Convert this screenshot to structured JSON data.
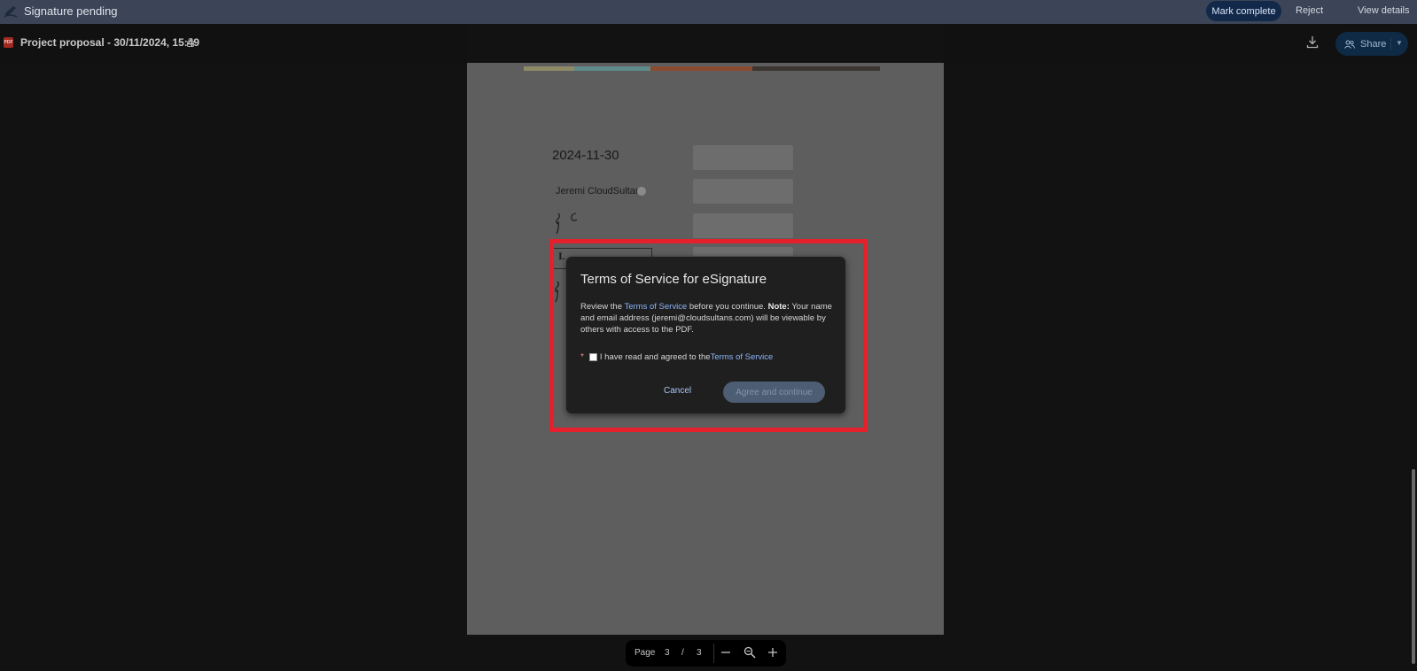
{
  "topbar": {
    "status": "Signature pending",
    "mark_complete": "Mark complete",
    "reject": "Reject",
    "view_details": "View details"
  },
  "file": {
    "pdf_badge": "PDF",
    "title": "Project proposal - 30/11/2024, 15:49",
    "share": "Share"
  },
  "document": {
    "date": "2024-11-30",
    "name": "Jeremi CloudSultan",
    "sig_initials": "J C",
    "box_text": "L",
    "color_strip": [
      "#8f8a66",
      "#5e8a8a",
      "#8a4a2f",
      "#3a3530"
    ]
  },
  "dialog": {
    "title": "Terms of Service for eSignature",
    "body_prefix": "Review the ",
    "body_link": "Terms of Service",
    "body_mid": " before you continue. ",
    "body_note_label": "Note:",
    "body_suffix": " Your name and email address (jeremi@cloudsultans.com) will be viewable by others with access to the PDF.",
    "required_mark": "*",
    "checkbox_prefix": "I have read and agreed to the ",
    "checkbox_link": "Terms of Service",
    "checkbox_checked": false,
    "cancel": "Cancel",
    "agree": "Agree and continue"
  },
  "pagenav": {
    "label": "Page",
    "current": "3",
    "slash": "/",
    "total": "3"
  },
  "colors": {
    "highlight": "#e3202b",
    "link": "#8ab4f8",
    "topbar": "#3b4557"
  }
}
